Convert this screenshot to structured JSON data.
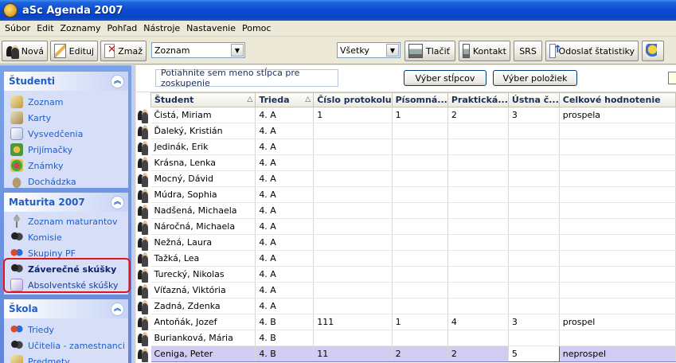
{
  "window": {
    "title": "aSc Agenda 2007"
  },
  "menu": [
    "Súbor",
    "Edit",
    "Zoznamy",
    "Pohľad",
    "Nástroje",
    "Nastavenie",
    "Pomoc"
  ],
  "toolbar": {
    "new_label": "Nová",
    "edit_label": "Edituj",
    "delete_label": "Zmaž",
    "list_select_value": "Zoznam",
    "filter_select_value": "Všetky",
    "print_label": "Tlačiť",
    "contact_label": "Kontakt",
    "srs_label": "SRS",
    "send_stats_label": "Odoslať štatistiky"
  },
  "sidebar": {
    "panels": [
      {
        "title": "Študenti",
        "items": [
          "Zoznam",
          "Karty",
          "Vysvedčenia",
          "Prijímačky",
          "Známky",
          "Dochádzka"
        ]
      },
      {
        "title": "Maturita 2007",
        "items": [
          "Zoznam maturantov",
          "Komisie",
          "Skupiny PF",
          "Záverečné skúšky",
          "Absolventské skúšky"
        ]
      },
      {
        "title": "Škola",
        "items": [
          "Triedy",
          "Učitelia - zamestnanci",
          "Predmety"
        ]
      }
    ],
    "active_item": "Záverečné skúšky"
  },
  "grid": {
    "group_hint": "Potiahnite sem meno stĺpca pre zoskupenie",
    "select_columns_label": "Výber stĺpcov",
    "select_items_label": "Výber položiek",
    "columns": [
      "Študent",
      "Trieda",
      "Číslo protokolu",
      "Písomná...",
      "Praktická...",
      "Ústna č...",
      "Celkové hodnotenie"
    ],
    "rows": [
      [
        "Čistá, Miriam",
        "4. A",
        "1",
        "1",
        "2",
        "3",
        "prospela"
      ],
      [
        "Ďaleký, Kristián",
        "4. A",
        "",
        "",
        "",
        "",
        ""
      ],
      [
        "Jedinák, Erik",
        "4. A",
        "",
        "",
        "",
        "",
        ""
      ],
      [
        "Krásna, Lenka",
        "4. A",
        "",
        "",
        "",
        "",
        ""
      ],
      [
        "Mocný, Dávid",
        "4. A",
        "",
        "",
        "",
        "",
        ""
      ],
      [
        "Múdra, Sophia",
        "4. A",
        "",
        "",
        "",
        "",
        ""
      ],
      [
        "Nadšená, Michaela",
        "4. A",
        "",
        "",
        "",
        "",
        ""
      ],
      [
        "Náročná, Michaela",
        "4. A",
        "",
        "",
        "",
        "",
        ""
      ],
      [
        "Nežná, Laura",
        "4. A",
        "",
        "",
        "",
        "",
        ""
      ],
      [
        "Tažká, Lea",
        "4. A",
        "",
        "",
        "",
        "",
        ""
      ],
      [
        "Turecký, Nikolas",
        "4. A",
        "",
        "",
        "",
        "",
        ""
      ],
      [
        "Víťazná, Viktória",
        "4. A",
        "",
        "",
        "",
        "",
        ""
      ],
      [
        "Zadná, Zdenka",
        "4. A",
        "",
        "",
        "",
        "",
        ""
      ],
      [
        "Antoňák, Jozef",
        "4. B",
        "111",
        "1",
        "4",
        "3",
        "prospel"
      ],
      [
        "Burianková, Mária",
        "4. B",
        "",
        "",
        "",
        "",
        ""
      ],
      [
        "Ceniga, Peter",
        "4. B",
        "11",
        "2",
        "2",
        "5",
        "neprospel"
      ]
    ],
    "selected_row": 15
  }
}
